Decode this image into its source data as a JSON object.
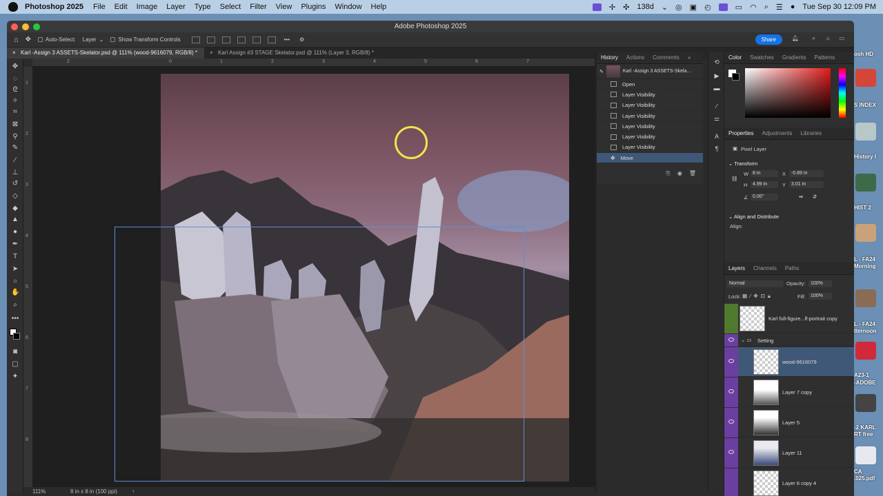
{
  "menubar": {
    "app": "Photoshop 2025",
    "items": [
      "File",
      "Edit",
      "Image",
      "Layer",
      "Type",
      "Select",
      "Filter",
      "View",
      "Plugins",
      "Window",
      "Help"
    ],
    "battery_text": "138d",
    "datetime": "Tue Sep 30  12:09 PM"
  },
  "desktop": {
    "labels": [
      "osh HD",
      "S INDEX",
      "History I",
      "HIST 2",
      "L - FA24",
      "Morning",
      "L - FA24",
      "tternoon",
      "A23-1",
      "-ADOBE",
      "-2 KARL",
      "RT free",
      "CA",
      ".025.pdf"
    ]
  },
  "window": {
    "title": "Adobe Photoshop 2025"
  },
  "options": {
    "auto_select_label": "Auto-Select:",
    "auto_select_value": "Layer",
    "show_transform": "Show Transform Controls",
    "share": "Share"
  },
  "tabs": [
    {
      "label": "Karl -Assign 3 ASSETS-Skelator.psd @ 111% (wood-9616079, RGB/8) *"
    },
    {
      "label": "Karl Assign #3 STAGE Skelator.psd @ 111% (Layer 3, RGB/8) *"
    }
  ],
  "ruler": {
    "top": [
      "2",
      "0",
      "1",
      "2",
      "3",
      "4",
      "5",
      "6",
      "7"
    ],
    "left": [
      "1",
      "2",
      "3",
      "4",
      "5",
      "6",
      "7",
      "8"
    ]
  },
  "status": {
    "zoom": "111%",
    "doc_size": "8 in x 8 in (100 ppi)"
  },
  "history": {
    "tabs": [
      "History",
      "Actions",
      "Comments"
    ],
    "snapshot": "Karl -Assign 3 ASSETS-Skela...",
    "items": [
      "Open",
      "Layer Visibility",
      "Layer Visibility",
      "Layer Visibility",
      "Layer Visibility",
      "Layer Visibility",
      "Layer Visibility",
      "Move"
    ]
  },
  "color_panel": {
    "tabs": [
      "Color",
      "Swatches",
      "Gradients",
      "Patterns"
    ]
  },
  "properties": {
    "tabs": [
      "Properties",
      "Adjustments",
      "Libraries"
    ],
    "kind": "Pixel Layer",
    "transform_title": "Transform",
    "w_label": "W",
    "w_value": "8 in",
    "x_label": "X",
    "x_value": "-0.89 in",
    "h_label": "H",
    "h_value": "4.99 in",
    "y_label": "Y",
    "y_value": "3.01 in",
    "angle": "0.00°",
    "align_title": "Align and Distribute",
    "align_label": "Align:"
  },
  "layers": {
    "tabs": [
      "Layers",
      "Channels",
      "Paths"
    ],
    "blend_mode": "Normal",
    "opacity_label": "Opacity:",
    "opacity": "100%",
    "lock_label": "Lock:",
    "fill_label": "Fill:",
    "fill": "100%",
    "group": "Setting",
    "rows": [
      {
        "name": "Karl full-figure...lf-portrait copy",
        "color": "#4f7a2e",
        "visible": false
      },
      {
        "name": "wood-9616079",
        "color": "#6a3fa0",
        "visible": true,
        "selected": true
      },
      {
        "name": "Layer 7 copy",
        "color": "#6a3fa0",
        "visible": true
      },
      {
        "name": "Layer 5",
        "color": "#6a3fa0",
        "visible": true
      },
      {
        "name": "Layer 11",
        "color": "#6a3fa0",
        "visible": true
      },
      {
        "name": "Layer 6 copy 4",
        "color": "#6a3fa0",
        "visible": true
      }
    ]
  }
}
